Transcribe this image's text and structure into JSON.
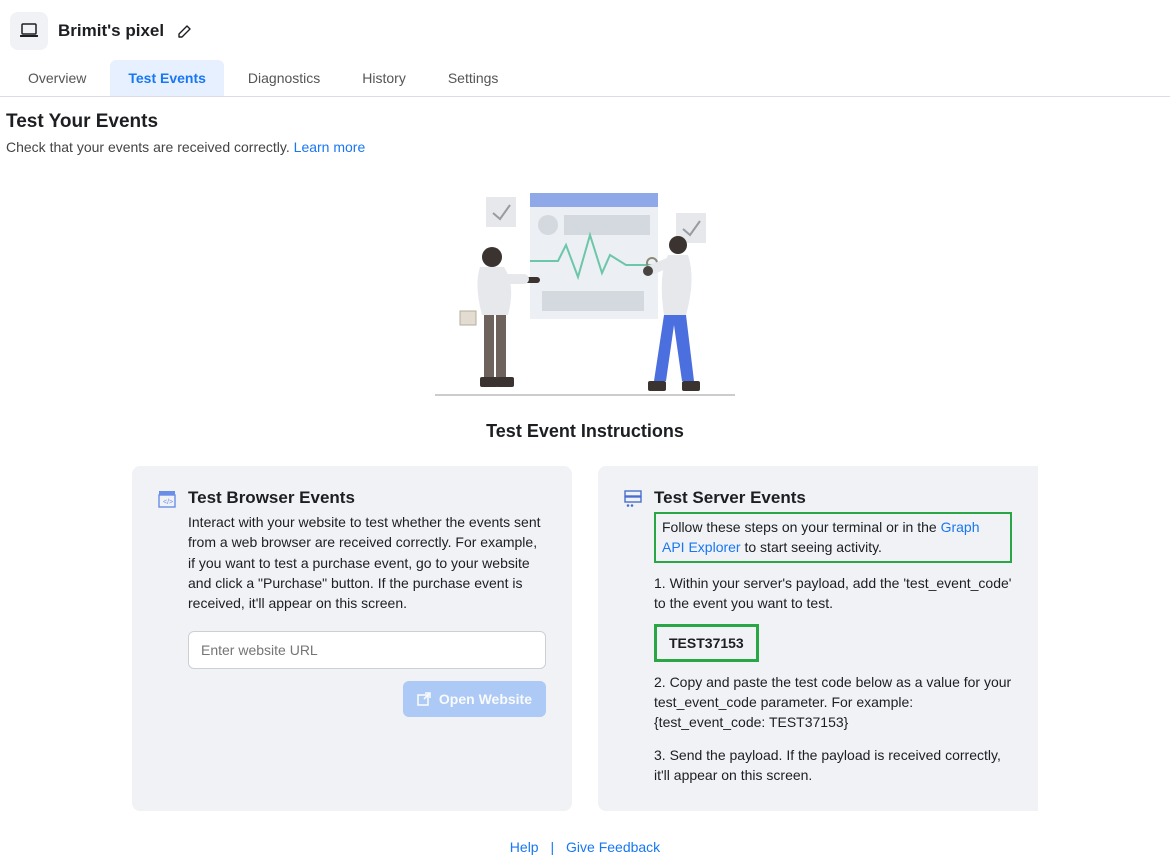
{
  "header": {
    "pixel_name": "Brimit's pixel"
  },
  "tabs": [
    {
      "label": "Overview",
      "active": false
    },
    {
      "label": "Test Events",
      "active": true
    },
    {
      "label": "Diagnostics",
      "active": false
    },
    {
      "label": "History",
      "active": false
    },
    {
      "label": "Settings",
      "active": false
    }
  ],
  "page": {
    "title": "Test Your Events",
    "subtitle_prefix": "Check that your events are received correctly. ",
    "learn_more": "Learn more"
  },
  "instructions_title": "Test Event Instructions",
  "browser_card": {
    "title": "Test Browser Events",
    "desc": "Interact with your website to test whether the events sent from a web browser are received correctly. For example, if you want to test a purchase event, go to your website and click a \"Purchase\" button. If the purchase event is received, it'll appear on this screen.",
    "placeholder": "Enter website URL",
    "open_btn": "Open Website"
  },
  "server_card": {
    "title": "Test Server Events",
    "intro_prefix": "Follow these steps on your terminal or in the ",
    "intro_link": "Graph API Explorer",
    "intro_suffix": " to start seeing activity.",
    "step1": "1. Within your server's payload, add the 'test_event_code' to the event you want to test.",
    "test_code": "TEST37153",
    "step2": "2. Copy and paste the test code below as a value for your test_event_code parameter. For example: {test_event_code: TEST37153}",
    "step3": "3. Send the payload. If the payload is received correctly, it'll appear on this screen."
  },
  "footer": {
    "help": "Help",
    "feedback": "Give Feedback"
  }
}
